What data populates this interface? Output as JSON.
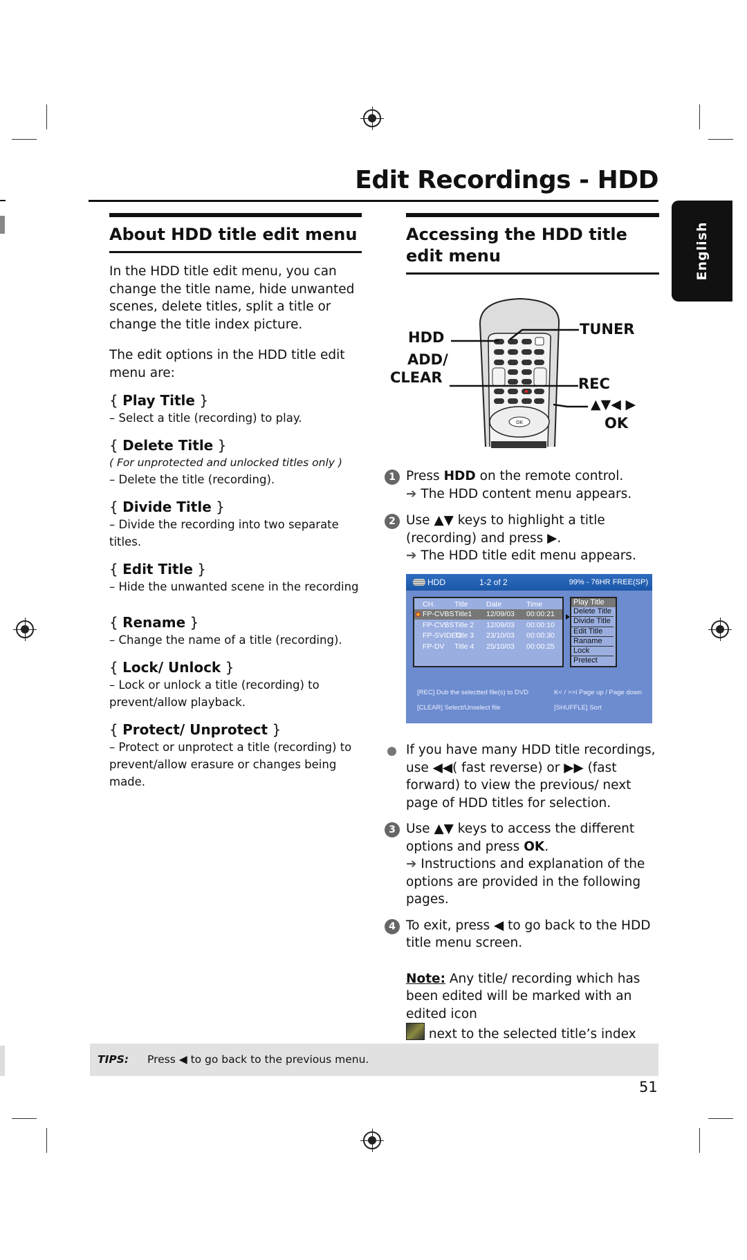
{
  "page": {
    "title": "Edit Recordings - HDD",
    "language_tab": "English",
    "page_number": "51"
  },
  "left": {
    "heading": "About HDD title edit menu",
    "intro1": "In the HDD title edit menu, you can change the title name, hide unwanted scenes, delete titles, split a title or change the title index picture.",
    "intro2": "The edit options in the HDD title edit menu are:",
    "options": [
      {
        "name": "Play Title",
        "desc": "–  Select a title (recording) to play."
      },
      {
        "name": "Delete Title",
        "note": "( For unprotected and unlocked titles only )",
        "desc": "–  Delete the title (recording)."
      },
      {
        "name": "Divide Title",
        "desc": "–  Divide the recording into two separate titles."
      },
      {
        "name": "Edit Title",
        "desc": "–  Hide the unwanted scene in the recording"
      },
      {
        "name": "Rename",
        "desc": "–  Change the name of a title (recording)."
      },
      {
        "name": "Lock/ Unlock",
        "desc": "–  Lock or unlock a title (recording) to prevent/allow playback."
      },
      {
        "name": "Protect/ Unprotect",
        "desc": "–  Protect or unprotect a title (recording) to prevent/allow erasure or changes being made."
      }
    ]
  },
  "right": {
    "heading": "Accessing the HDD title edit menu",
    "remote_labels": {
      "hdd": "HDD",
      "add": "ADD/",
      "clear": "CLEAR",
      "tuner": "TUNER",
      "rec": "REC",
      "arrows": "▲▼◀ ▶",
      "ok": "OK"
    },
    "steps": [
      {
        "num": "1",
        "pre": "Press ",
        "bold": "HDD",
        "post": " on the remote control.",
        "result": "The HDD content menu appears."
      },
      {
        "num": "2",
        "text": "Use ▲▼ keys to highlight a title (recording) and press ▶.",
        "result": "The HDD title edit menu appears."
      },
      {
        "num": "3",
        "pre": "Use ▲▼ keys to access the different options and press ",
        "bold": "OK",
        "post": ".",
        "result": "Instructions and explanation of the options are provided in the following pages."
      },
      {
        "num": "4",
        "text": "To exit, press ◀ to go back to the HDD title menu screen."
      }
    ],
    "bullet": "If you have many HDD title recordings, use ◀◀( fast reverse) or ▶▶ (fast forward) to view the previous/ next page of HDD titles for selection.",
    "note_label": "Note:",
    "note_text1": " Any title/ recording which has been edited will be marked with an edited icon",
    "note_text2": " next to the selected title’s index picture.",
    "result_arrow": "➔"
  },
  "screen": {
    "header_left": "HDD",
    "header_mid": "1-2  of  2",
    "header_right": "99% - 76HR  FREE(SP)",
    "columns": [
      "CH.",
      "Title",
      "Date",
      "Time"
    ],
    "rows": [
      [
        "FP-CVBS",
        "Title1",
        "12/09/03",
        "00:00:21"
      ],
      [
        "FP-CVBS",
        "Title 2",
        "12/09/03",
        "00:00:10"
      ],
      [
        "FP-SVIDEO",
        "Title 3",
        "23/10/03",
        "00:00:30"
      ],
      [
        "FP-DV",
        "Title 4",
        "25/10/03",
        "00:00:25"
      ]
    ],
    "menu": [
      "Play Title",
      "Delete Title",
      "Divide Title",
      "Edit Title",
      "Raname",
      "Lock",
      "Pretect"
    ],
    "footer": [
      "[REC]  Dub the selectted file(s) to DVD",
      "K< / >>I  Page up / Page down",
      "[CLEAR]  Select/Unselect file",
      "[SHUFFLE]  Sort"
    ],
    "colors": {
      "background": "#6c8ccf",
      "header": "#1b57a8"
    }
  },
  "tips": {
    "label": "TIPS:",
    "text": "Press ◀ to go back to the previous menu."
  }
}
